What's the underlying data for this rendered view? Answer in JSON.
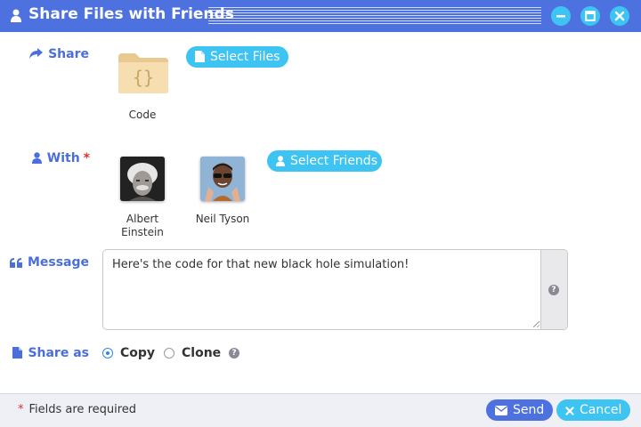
{
  "window": {
    "title": "Share Files with Friends",
    "accent_color": "#4d72e0",
    "button_color": "#3ec4f2",
    "controls": [
      "minimize-icon",
      "maximize-icon",
      "close-icon"
    ]
  },
  "share": {
    "label": "Share",
    "icon": "share-arrow-icon",
    "select_button": "Select Files",
    "files": [
      {
        "name": "Code",
        "icon": "folder-code-icon"
      }
    ]
  },
  "with": {
    "label": "With",
    "required_mark": "*",
    "icon": "user-icon",
    "select_button": "Select Friends",
    "friends": [
      {
        "name": "Albert Einstein",
        "avatar": "avatar-albert-einstein"
      },
      {
        "name": "Neil Tyson",
        "avatar": "avatar-neil-tyson"
      }
    ]
  },
  "message": {
    "label": "Message",
    "icon": "quote-icon",
    "value": "Here's the code for that new black hole simulation!",
    "help": "?"
  },
  "share_as": {
    "label": "Share as",
    "icon": "file-icon",
    "options": [
      {
        "label": "Copy",
        "checked": true
      },
      {
        "label": "Clone",
        "checked": false
      }
    ],
    "help": "?"
  },
  "footer": {
    "required_mark": "*",
    "note": "Fields are required",
    "send_label": "Send",
    "cancel_label": "Cancel"
  }
}
